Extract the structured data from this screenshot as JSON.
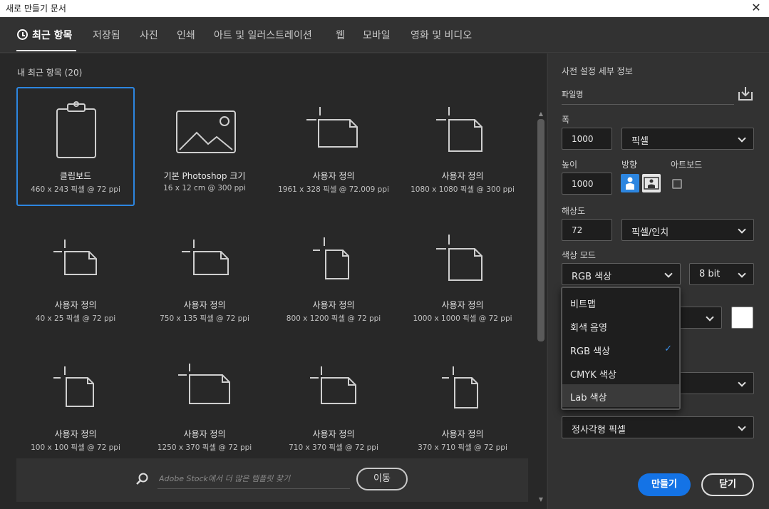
{
  "window": {
    "title": "새로 만들기 문서",
    "close_icon": "close-icon"
  },
  "tabs": [
    {
      "label": "최근 항목",
      "active": true,
      "icon": "clock-icon"
    },
    {
      "label": "저장됨"
    },
    {
      "label": "사진"
    },
    {
      "label": "인쇄"
    },
    {
      "label": "아트 및 일러스트레이션"
    },
    {
      "label": "웹"
    },
    {
      "label": "모바일"
    },
    {
      "label": "영화 및 비디오"
    }
  ],
  "recent": {
    "heading": "내 최근 항목 (20)",
    "items": [
      {
        "name": "클립보드",
        "dims": "460 x 243 픽셀 @ 72 ppi",
        "icon": "clipboard-icon",
        "selected": true
      },
      {
        "name": "기본 Photoshop 크기",
        "dims": "16 x 12 cm @ 300 ppi",
        "icon": "image-icon"
      },
      {
        "name": "사용자 정의",
        "dims": "1961 x 328 픽셀 @ 72.009 ppi",
        "icon": "custom-landscape-icon"
      },
      {
        "name": "사용자 정의",
        "dims": "1080 x 1080 픽셀 @ 300 ppi",
        "icon": "custom-portrait-icon"
      },
      {
        "name": "사용자 정의",
        "dims": "40 x 25 픽셀 @ 72 ppi",
        "icon": "custom-landscape-icon"
      },
      {
        "name": "사용자 정의",
        "dims": "750 x 135 픽셀 @ 72 ppi",
        "icon": "custom-landscape-icon"
      },
      {
        "name": "사용자 정의",
        "dims": "800 x 1200 픽셀 @ 72 ppi",
        "icon": "custom-portrait-icon"
      },
      {
        "name": "사용자 정의",
        "dims": "1000 x 1000 픽셀 @ 72 ppi",
        "icon": "custom-portrait-icon"
      },
      {
        "name": "사용자 정의",
        "dims": "100 x 100 픽셀 @ 72 ppi",
        "icon": "custom-portrait-icon"
      },
      {
        "name": "사용자 정의",
        "dims": "1250 x 370 픽셀 @ 72 ppi",
        "icon": "custom-landscape-icon"
      },
      {
        "name": "사용자 정의",
        "dims": "710 x 370 픽셀 @ 72 ppi",
        "icon": "custom-landscape-icon"
      },
      {
        "name": "사용자 정의",
        "dims": "370 x 710 픽셀 @ 72 ppi",
        "icon": "custom-portrait-icon"
      }
    ]
  },
  "search": {
    "placeholder": "Adobe Stock에서 더 많은 템플릿 찾기",
    "button": "이동",
    "icon": "search-icon"
  },
  "preset": {
    "heading": "사전 설정 세부 정보",
    "filename": "파일명",
    "save_icon": "save-preset-icon",
    "width_label": "폭",
    "width_value": "1000",
    "width_unit": "픽셀",
    "height_label": "높이",
    "height_value": "1000",
    "orientation_label": "방향",
    "artboard_label": "아트보드",
    "artboard_checked": false,
    "resolution_label": "해상도",
    "resolution_value": "72",
    "resolution_unit": "픽셀/인치",
    "colormode_label": "색상 모드",
    "colormode_value": "RGB 색상",
    "bitdepth_value": "8 bit",
    "background_color": "#ffffff",
    "pixel_aspect_value": "정사각형 픽셀"
  },
  "colormode_dropdown": {
    "options": [
      "비트맵",
      "회색 음영",
      "RGB 색상",
      "CMYK 색상",
      "Lab 색상"
    ],
    "selected": "RGB 색상",
    "hovered": "Lab 색상",
    "check_glyph": "✓"
  },
  "footer": {
    "create": "만들기",
    "close": "닫기"
  },
  "colors": {
    "accent": "#1473e6",
    "selection_border": "#2d86e0"
  }
}
